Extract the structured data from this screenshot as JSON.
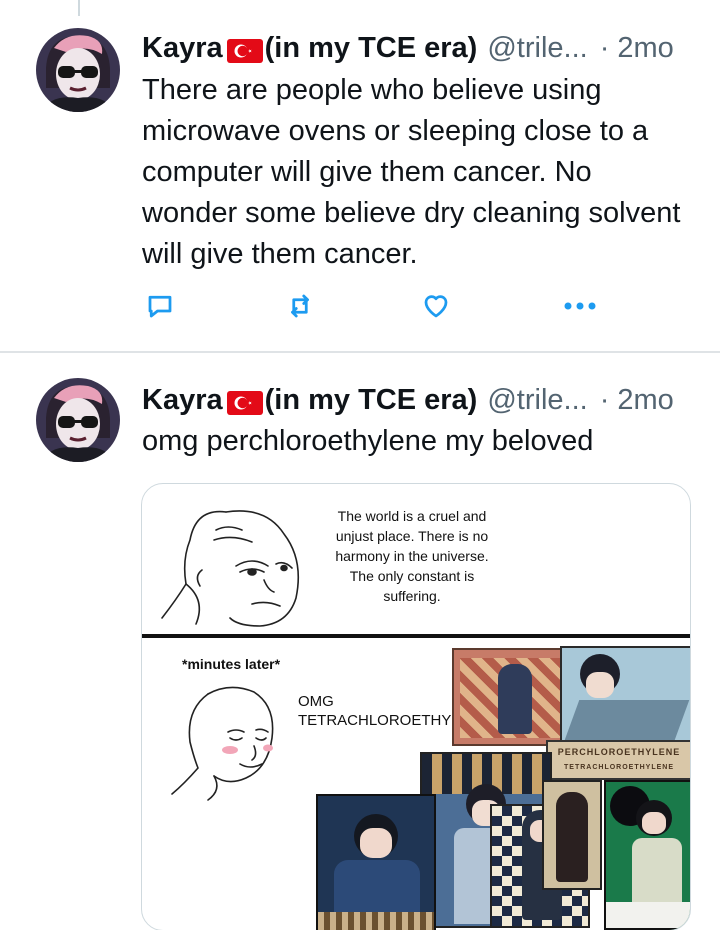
{
  "tweets": [
    {
      "display_name": "Kayra",
      "name_suffix": "(in my TCE era)",
      "handle": "@trile...",
      "separator": "·",
      "time": "2mo",
      "text": "There are people who believe using microwave ovens or sleeping close to a computer will give them cancer. No wonder some believe dry cleaning solvent will give them cancer."
    },
    {
      "display_name": "Kayra",
      "name_suffix": "(in my TCE era)",
      "handle": "@trile...",
      "separator": "·",
      "time": "2mo",
      "text": "omg perchloroethylene my beloved",
      "media": {
        "top_caption": "The world is a cruel and unjust place. There is no harmony in the universe. The only constant is suffering.",
        "minutes_later": "*minutes later*",
        "omg_line1": "OMG",
        "omg_line2": "TETRACHLOROETHYLENE",
        "art_banner": "PERCHLOROETHYLENE",
        "art_banner_sub": "TETRACHLOROETHYLENE"
      }
    }
  ],
  "icons": [
    "reply-icon",
    "retweet-icon",
    "like-icon",
    "more-icon",
    "turkey-flag-icon"
  ],
  "colors": {
    "text": "#0f1419",
    "secondary": "#536471",
    "action_icon": "#1d9bf0",
    "divider": "#dfe3e6",
    "flag_red": "#e30a17"
  }
}
